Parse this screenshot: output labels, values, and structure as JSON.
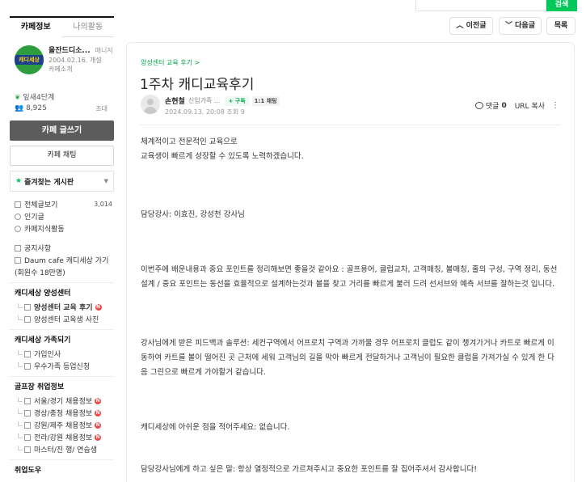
{
  "top": {
    "search_button": "검색"
  },
  "sidebar": {
    "tabs": [
      {
        "label": "카페정보"
      },
      {
        "label": "나의활동"
      }
    ],
    "cafe": {
      "logo_text": "캐디세상",
      "name": "올잔드디소...",
      "manager": "매니저",
      "founded": "2004.02.16. 개설",
      "intro": "카페소개"
    },
    "level": "잎새4단계",
    "members": "8,925",
    "invite": "초대",
    "write_button": "카페 글쓰기",
    "chat_button": "카페 채팅",
    "favorites": "즐겨찾는 게시판",
    "menu": [
      {
        "label": "전체글보기",
        "count": "3,014"
      },
      {
        "label": "인기글"
      },
      {
        "label": "카페지식활동"
      }
    ],
    "menu2": [
      {
        "label": "공지사항"
      },
      {
        "label": "Daum cafe 캐디세상 가기"
      },
      {
        "label": "(회원수 18만명)"
      }
    ],
    "sections": [
      {
        "title": "캐디세상 양성센터",
        "items": [
          {
            "label": "양성센터 교육 후기",
            "badge": "N",
            "bold": true
          },
          {
            "label": "양성센터 교육생 사진"
          }
        ]
      },
      {
        "title": "캐디세상 가족되기",
        "items": [
          {
            "label": "가입인사"
          },
          {
            "label": "우수가족 등업신청"
          }
        ]
      },
      {
        "title": "골프장 취업정보",
        "items": [
          {
            "label": "서울/경기 채용정보",
            "badge": "N"
          },
          {
            "label": "경상/충청 채용정보",
            "badge": "N"
          },
          {
            "label": "강원/제주 채용정보",
            "badge": "N"
          },
          {
            "label": "전라/강원 채용정보",
            "badge": "N"
          },
          {
            "label": "마스터/진 행/ 연습생"
          }
        ]
      }
    ],
    "cut_section": "취업도우"
  },
  "nav": {
    "prev": "이전글",
    "next": "다음글",
    "list": "목록"
  },
  "article": {
    "breadcrumb": "양성센터 교육 후기 >",
    "title": "1주차 캐디교육후기",
    "author": "손현철",
    "rank": "신입가족 ...",
    "subscribe": "+ 구독",
    "chat": "1:1 채팅",
    "date": "2024.09.13. 20:08",
    "views": "조회 9",
    "comment_label": "댓글",
    "comment_count": "0",
    "url_copy": "URL 복사",
    "paragraphs": [
      "체계적이고 전문적인 교육으로\n교육생이 빠르게 성장할 수 있도록 노력하겠습니다.",
      "담당강사:  이효진, 강성천 강사님",
      "이번주에 배운내용과 중요 포인트를 정리해보면 좋을것 같아요 :  골프용어, 클럽교차, 고객매칭, 볼매칭, 홀의 구성, 구역 정리, 동선설계 / 중요 포인트는 동선을 효율적으로 설계하는것과 볼을 찾고 거리를 빠르게 불러 드려 선서브와 예측 서브를 잘하는것 입니다.",
      "강사님에게 받은 피드백과 솔루션:  세컨구역에서 어프로치 구역과 가까울 경우 어프로치 클럽도 같이 챙겨가거나 카트로 빠르게 이동하여 카트를 볼이 떨어진 곳 근처에 세워 고객님의 길을 막아 빠르게 전달하거나 고객님이 필요한 클럽을 가져가실 수 있게 한 다음 그린으로 빠르게 가야할거 같습니다.",
      "캐디세상에 아쉬운 점을 적어주세요: 없습니다.",
      "담당강사님에게 하고 싶은 말: 항상 열정적으로 가르쳐주시고 중요한 포인트를 잘 집어주셔서 감사합니다!"
    ]
  }
}
